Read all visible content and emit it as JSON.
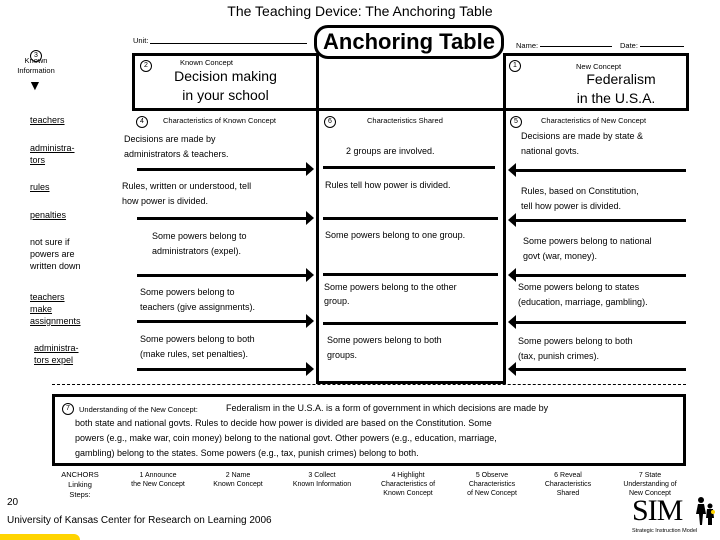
{
  "page_title": "The Teaching Device:  The Anchoring Table",
  "header": {
    "unit_label": "Unit:",
    "table_title": "Anchoring Table",
    "name_label": "Name:",
    "date_label": "Date:"
  },
  "known_information": {
    "number": "3",
    "label_line1": "Known",
    "label_line2": "Information",
    "items": [
      {
        "text": "teachers",
        "underlined": true
      },
      {
        "text": "administra-\ntors",
        "underlined": true
      },
      {
        "text": "rules",
        "underlined": true
      },
      {
        "text": "penalties",
        "underlined": true
      },
      {
        "text": "not sure if\npowers are\nwritten down",
        "underlined": false
      },
      {
        "text": "teachers\nmake\nassignments",
        "underlined": true
      },
      {
        "text": "administra-\ntors expel",
        "underlined": true
      }
    ]
  },
  "known_concept": {
    "number": "2",
    "label": "Known Concept",
    "title_line1": "Decision making",
    "title_line2": "in your school"
  },
  "new_concept": {
    "number": "1",
    "label": "New Concept",
    "title_line1": "Federalism",
    "title_line2": "in the U.S.A."
  },
  "characteristics_known": {
    "number": "4",
    "label": "Characteristics of Known Concept",
    "rows": [
      [
        "Decisions are made by",
        "administrators & teachers."
      ],
      [
        "Rules, written or understood, tell",
        "how power is divided."
      ],
      [
        "Some powers belong to",
        "administrators (expel)."
      ],
      [
        "Some powers belong to",
        "teachers (give assignments)."
      ],
      [
        "Some powers belong to both",
        "(make rules, set penalties)."
      ]
    ]
  },
  "characteristics_shared": {
    "number": "6",
    "label": "Characteristics Shared",
    "rows": [
      [
        "2 groups are involved."
      ],
      [
        "Rules tell how power is divided."
      ],
      [
        "Some powers belong to one group."
      ],
      [
        "Some powers belong to the other",
        "group."
      ],
      [
        "Some powers belong to both",
        "groups."
      ]
    ]
  },
  "characteristics_new": {
    "number": "5",
    "label": "Characteristics of New Concept",
    "rows": [
      [
        "Decisions are made by state &",
        "national govts."
      ],
      [
        "Rules, based on Constitution,",
        "tell how power is divided."
      ],
      [
        "Some powers belong to national",
        "govt (war, money)."
      ],
      [
        "Some powers belong to states",
        "(education, marriage, gambling)."
      ],
      [
        "Some powers belong to both",
        "(tax, punish crimes)."
      ]
    ]
  },
  "understanding": {
    "number": "7",
    "label": "Understanding of the New Concept:",
    "lines": [
      "Federalism in the U.S.A.  is a form of government in which decisions are made by",
      "both state and national govts.  Rules to decide how power is divided are based on the Constitution.  Some",
      "powers (e.g., make war, coin money) belong to the national govt.  Other powers (e.g., education, marriage,",
      "gambling) belong to the states.  Some powers (e.g., tax, punish crimes) belong to both."
    ]
  },
  "linking_steps": {
    "label_lines": [
      "ANCHORS",
      "Linking",
      "Steps:"
    ],
    "steps": [
      [
        "1 Announce",
        "the New Concept"
      ],
      [
        "2 Name",
        "Known Concept"
      ],
      [
        "3 Collect",
        "Known Information"
      ],
      [
        "4 Highlight",
        "Characteristics of",
        "Known Concept"
      ],
      [
        "5 Observe",
        "Characteristics",
        "of New Concept"
      ],
      [
        "6 Reveal",
        "Characteristics",
        "Shared"
      ],
      [
        "7 State",
        "Understanding of",
        "New Concept"
      ]
    ]
  },
  "footer": {
    "page_number": "20",
    "credit": "University of Kansas Center for Research on Learning 2006",
    "logo_text": "SIM",
    "logo_subtitle": "Strategic Instruction Model",
    "accent_color": "#FFD400"
  }
}
